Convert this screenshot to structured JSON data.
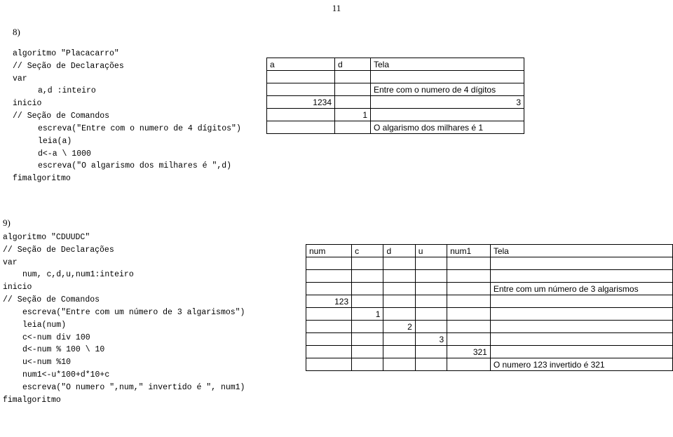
{
  "pageNumber": "11",
  "ex8": {
    "label": "8)",
    "code": {
      "l1": "algoritmo \"Placacarro\"",
      "l2": "// Seção de Declarações",
      "l3": "var",
      "l4": "a,d :inteiro",
      "l5": "inicio",
      "l6": "// Seção de Comandos",
      "l7": "escreva(\"Entre com o numero de 4 dígitos\")",
      "l8": "leia(a)",
      "l9": "d<-a \\ 1000",
      "l10": "escreva(\"O algarismo dos milhares é \",d)",
      "l11": "fimalgoritmo"
    },
    "table": {
      "h1": "a",
      "h2": "d",
      "h3": "Tela",
      "r2c3": "Entre com o numero de 4 dígitos",
      "r3c1": "1234",
      "r3c3": "3",
      "r4c2": "1",
      "r5c3": "O algarismo dos milhares é 1"
    }
  },
  "ex9": {
    "label": "9)",
    "code": {
      "l1": "algoritmo \"CDUUDC\"",
      "l2": "// Seção de Declarações",
      "l3": "var",
      "l4": "num, c,d,u,num1:inteiro",
      "l5": "inicio",
      "l6": "// Seção de Comandos",
      "l7": "escreva(\"Entre com um número de 3 algarismos\")",
      "l8": "leia(num)",
      "l9": "c<-num div 100",
      "l10": "d<-num % 100 \\ 10",
      "l11": "u<-num %10",
      "l12": "num1<-u*100+d*10+c",
      "l13": "escreva(\"O numero \",num,\" invertido é \", num1)",
      "l14": "fimalgoritmo"
    },
    "table": {
      "h1": "num",
      "h2": "c",
      "h3": "d",
      "h4": "u",
      "h5": "num1",
      "h6": "Tela",
      "r2c6": "Entre com um número de 3 algarismos",
      "r3c1": "123",
      "r4c2": "1",
      "r5c3": "2",
      "r6c4": "3",
      "r7c5": "321",
      "r8c6": "O numero 123 invertido é 321"
    }
  }
}
